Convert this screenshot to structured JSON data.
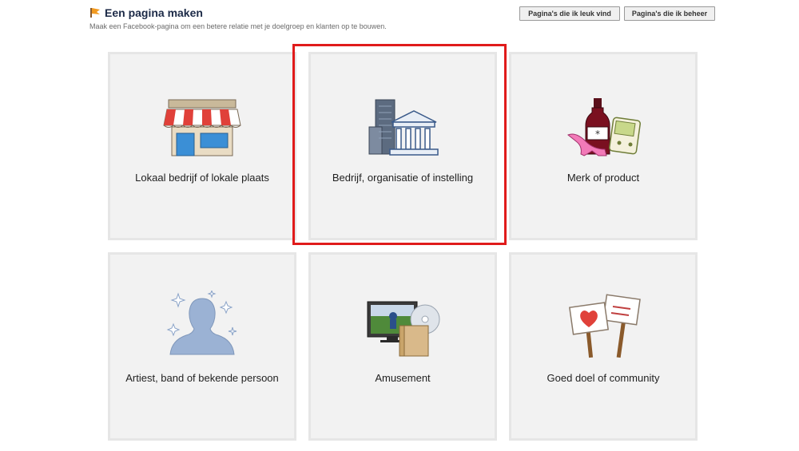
{
  "header": {
    "title": "Een pagina maken",
    "subtitle": "Maak een Facebook-pagina om een betere relatie met je doelgroep en klanten op te bouwen.",
    "icon": "flag-icon",
    "buttons": {
      "liked_pages": "Pagina's die ik leuk vind",
      "managed_pages": "Pagina's die ik beheer"
    }
  },
  "categories": [
    {
      "label": "Lokaal bedrijf of lokale plaats",
      "icon": "storefront-icon"
    },
    {
      "label": "Bedrijf, organisatie of instelling",
      "icon": "buildings-icon",
      "highlighted": true
    },
    {
      "label": "Merk of product",
      "icon": "products-icon"
    },
    {
      "label": "Artiest, band of bekende persoon",
      "icon": "person-silhouette-icon"
    },
    {
      "label": "Amusement",
      "icon": "tv-media-icon"
    },
    {
      "label": "Goed doel of community",
      "icon": "signs-icon"
    }
  ],
  "colors": {
    "highlight": "#e01b1b",
    "title": "#1c2a47",
    "tile_bg": "#f2f2f2"
  }
}
